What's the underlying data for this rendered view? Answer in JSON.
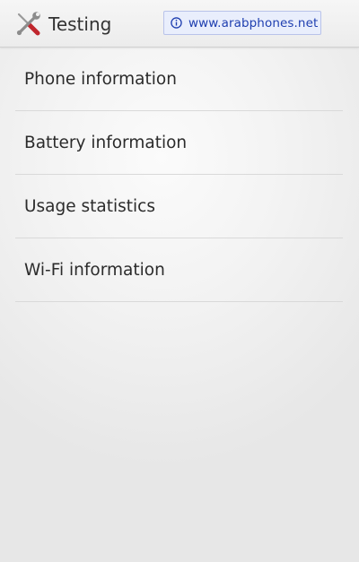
{
  "action_bar": {
    "icon": "tools-icon",
    "title": "Testing"
  },
  "watermark": {
    "icon": "info-icon",
    "text": "www.arabphones.net",
    "color": "#1f3fb0"
  },
  "menu": {
    "items": [
      {
        "label": "Phone information"
      },
      {
        "label": "Battery information"
      },
      {
        "label": "Usage statistics"
      },
      {
        "label": "Wi-Fi information"
      }
    ]
  }
}
